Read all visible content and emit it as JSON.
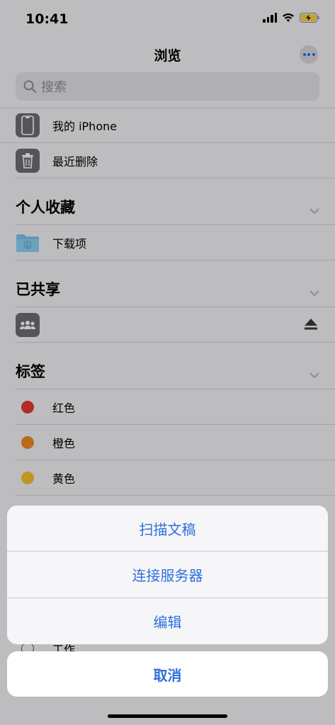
{
  "status": {
    "time": "10:41"
  },
  "nav": {
    "title": "浏览"
  },
  "search": {
    "placeholder": "搜索"
  },
  "locations": [
    {
      "label": "我的 iPhone",
      "icon": "iphone-icon"
    },
    {
      "label": "最近删除",
      "icon": "trash-icon"
    }
  ],
  "favorites": {
    "title": "个人收藏",
    "items": [
      {
        "label": "下载项",
        "icon": "folder-icon"
      }
    ]
  },
  "shared": {
    "title": "已共享",
    "items": [
      {
        "label": "",
        "icon": "shared-group-icon"
      }
    ]
  },
  "tags": {
    "title": "标签",
    "items": [
      {
        "label": "红色",
        "color": "#e53935"
      },
      {
        "label": "橙色",
        "color": "#ee8a25"
      },
      {
        "label": "黄色",
        "color": "#f2c12e"
      }
    ],
    "peek_label": "工作"
  },
  "action_sheet": {
    "items": [
      "扫描文稿",
      "连接服务器",
      "编辑"
    ],
    "cancel": "取消"
  },
  "colors": {
    "accent": "#2f6fdc"
  }
}
